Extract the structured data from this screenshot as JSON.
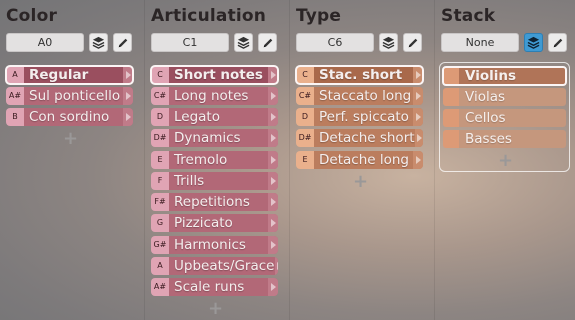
{
  "columns": {
    "color": {
      "title": "Color",
      "key": "A0",
      "items": [
        {
          "key": "A",
          "label": "Regular",
          "selected": true
        },
        {
          "key": "A#",
          "label": "Sul ponticello"
        },
        {
          "key": "B",
          "label": "Con sordino"
        }
      ],
      "add": "+"
    },
    "articulation": {
      "title": "Articulation",
      "key": "C1",
      "items": [
        {
          "key": "C",
          "label": "Short notes",
          "selected": true
        },
        {
          "key": "C#",
          "label": "Long notes"
        },
        {
          "key": "D",
          "label": "Legato"
        },
        {
          "key": "D#",
          "label": "Dynamics"
        },
        {
          "key": "E",
          "label": "Tremolo"
        },
        {
          "key": "F",
          "label": "Trills"
        },
        {
          "key": "F#",
          "label": "Repetitions"
        },
        {
          "key": "G",
          "label": "Pizzicato"
        },
        {
          "key": "G#",
          "label": "Harmonics"
        },
        {
          "key": "A",
          "label": "Upbeats/Grace"
        },
        {
          "key": "A#",
          "label": "Scale runs"
        }
      ],
      "add": "+"
    },
    "type": {
      "title": "Type",
      "key": "C6",
      "items": [
        {
          "key": "C",
          "label": "Stac. short",
          "selected": true
        },
        {
          "key": "C#",
          "label": "Staccato long"
        },
        {
          "key": "D",
          "label": "Perf. spiccato"
        },
        {
          "key": "D#",
          "label": "Detache short"
        },
        {
          "key": "E",
          "label": "Detache long"
        }
      ],
      "add": "+"
    },
    "stack": {
      "title": "Stack",
      "key": "None",
      "items": [
        {
          "label": "Violins",
          "selected": true
        },
        {
          "label": "Violas"
        },
        {
          "label": "Cellos"
        },
        {
          "label": "Basses"
        }
      ],
      "add": "+"
    }
  },
  "icons": {
    "layers": "layers-icon",
    "edit": "pencil-icon",
    "expand": "chevron-right-icon",
    "add": "plus-icon"
  },
  "colors": {
    "pink_row": "#b26877",
    "pink_key": "#e0a4b4",
    "orange_row": "#bb7d5e",
    "orange_key": "#eab08c",
    "stack_active": "#3f9ad3"
  }
}
